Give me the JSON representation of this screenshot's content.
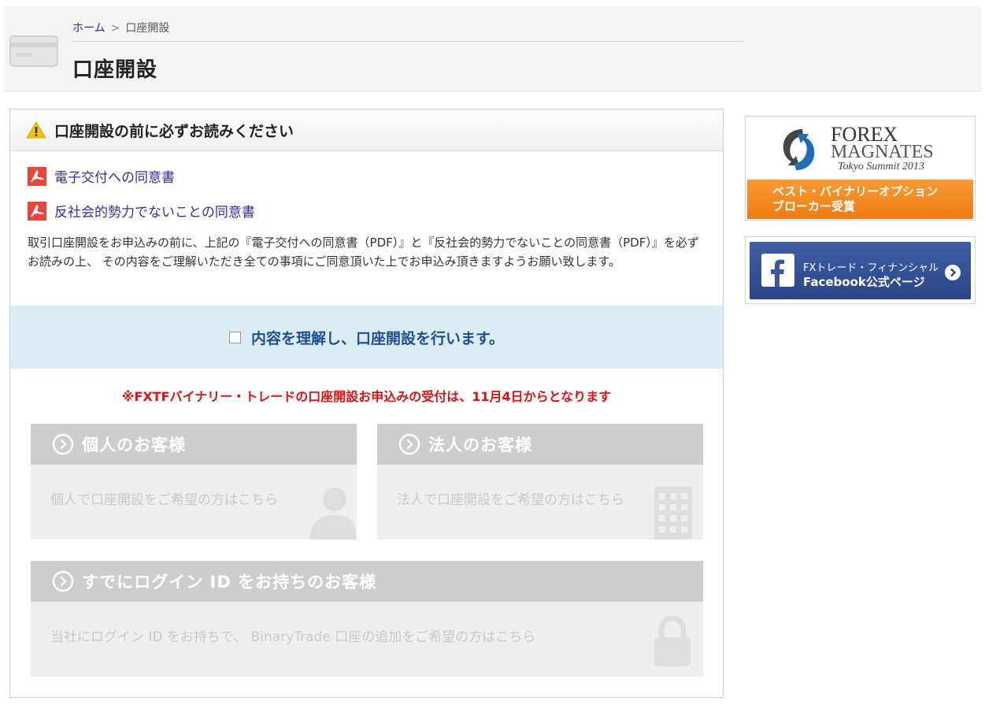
{
  "header": {
    "breadcrumb": {
      "home": "ホーム",
      "separator": ">",
      "current": "口座開設"
    },
    "title": "口座開設",
    "icon": "card-icon"
  },
  "notice": {
    "title": "口座開設の前に必ずお読みください",
    "icon": "warning-icon",
    "documents": [
      {
        "label": "電子交付への同意書",
        "icon": "pdf-icon"
      },
      {
        "label": "反社会的勢力でないことの同意書",
        "icon": "pdf-icon"
      }
    ],
    "body": "取引口座開設をお申込みの前に、上記の『電子交付への同意書（PDF）』と『反社会的勢力でないことの同意書（PDF）』を必ずお読みの上、 その内容をご理解いただき全ての事項にご同意頂いた上でお申込み頂きますようお願い致します。"
  },
  "agreement": {
    "label": "内容を理解し、口座開設を行います。",
    "checked": false
  },
  "announcement": "※FXTFバイナリー・トレードの口座開設お申込みの受付は、11月4日からとなります",
  "cards": {
    "individual": {
      "title": "個人のお客様",
      "description": "個人で口座開設をご希望の方はこちら",
      "icon": "person-icon"
    },
    "corporate": {
      "title": "法人のお客様",
      "description": "法人で口座開設をご希望の方はこちら",
      "icon": "building-icon"
    },
    "login": {
      "title": "すでにログイン ID をお持ちのお客様",
      "description": "当社にログイン ID をお持ちで、 BinaryTrade 口座の追加をご希望の方はこちら",
      "icon": "padlock-icon"
    }
  },
  "sidebar": {
    "forex_banner": {
      "line1": "FOREX",
      "line2": "MAGNATES",
      "line3": "Tokyo Summit 2013",
      "award_line1": "ベスト・バイナリーオプション",
      "award_line2": "ブローカー受賞",
      "award_color": "#f28a1e"
    },
    "facebook_banner": {
      "line1": "FXトレード・フィナンシャル",
      "line2": "Facebook公式ページ",
      "color": "#34509a"
    }
  },
  "colors": {
    "link": "#3b2a9a",
    "agree_band": "#dcecf5",
    "agree_text": "#1d4f91",
    "announcement": "#e01010",
    "card_disabled_head": "#cdcdcd",
    "card_disabled_body": "#efefef"
  }
}
